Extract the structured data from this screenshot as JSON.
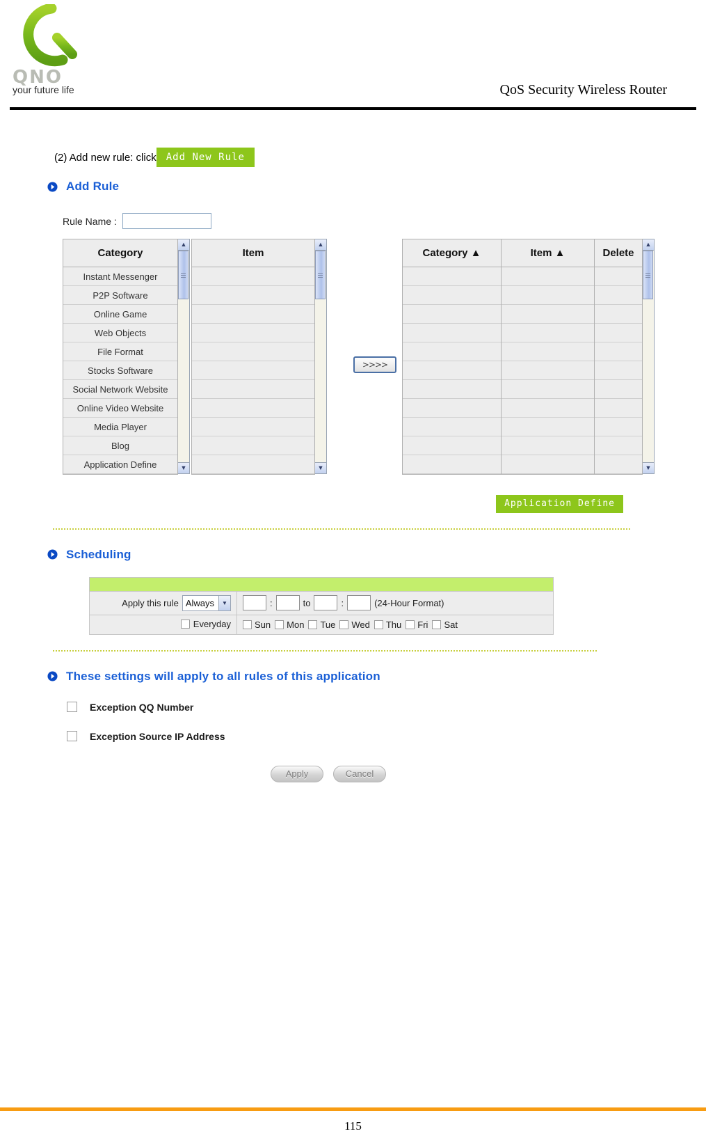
{
  "header": {
    "brand_mark": "QNO",
    "brand_tagline": "your future life",
    "title": "QoS Security Wireless Router"
  },
  "step": {
    "text": "(2) Add new rule: click",
    "button_label": "Add New Rule"
  },
  "add_rule": {
    "section_title": "Add Rule",
    "rule_name_label": "Rule Name :",
    "rule_name_value": "",
    "rule_name_placeholder": "",
    "available": {
      "category_header": "Category",
      "item_header": "Item",
      "categories": [
        "Instant Messenger",
        "P2P Software",
        "Online Game",
        "Web Objects",
        "File Format",
        "Stocks Software",
        "Social Network Website",
        "Online Video Website",
        "Media Player",
        "Blog",
        "Application Define"
      ],
      "items": [
        "",
        "",
        "",
        "",
        "",
        "",
        "",
        "",
        "",
        "",
        ""
      ]
    },
    "move_button_label": ">>>>",
    "selected": {
      "headers": [
        "Category ▲",
        "Item      ▲",
        "Delete"
      ],
      "rows": [
        [
          "",
          "",
          ""
        ],
        [
          "",
          "",
          ""
        ],
        [
          "",
          "",
          ""
        ],
        [
          "",
          "",
          ""
        ],
        [
          "",
          "",
          ""
        ],
        [
          "",
          "",
          ""
        ],
        [
          "",
          "",
          ""
        ],
        [
          "",
          "",
          ""
        ],
        [
          "",
          "",
          ""
        ],
        [
          "",
          "",
          ""
        ],
        [
          "",
          "",
          ""
        ]
      ]
    },
    "application_define_label": "Application Define"
  },
  "scheduling": {
    "section_title": "Scheduling",
    "apply_label": "Apply this rule",
    "apply_value": "Always",
    "apply_options": [
      "Always"
    ],
    "time_sep": ":",
    "to_label": "to",
    "format_note": "(24-Hour Format)",
    "start_hour": "",
    "start_minute": "",
    "end_hour": "",
    "end_minute": "",
    "everyday_label": "Everyday",
    "days": [
      "Sun",
      "Mon",
      "Tue",
      "Wed",
      "Thu",
      "Fri",
      "Sat"
    ]
  },
  "exceptions": {
    "section_title": "These settings will apply to all rules of this application",
    "items": [
      "Exception QQ Number",
      "Exception Source IP Address"
    ]
  },
  "actions": {
    "apply_label": "Apply",
    "cancel_label": "Cancel"
  },
  "footer": {
    "page_number": "115"
  },
  "colors": {
    "accent_green": "#8dc61b",
    "section_blue": "#1a5fd6",
    "footer_orange": "#f89c12",
    "schedule_bar_green": "#c3ee6c"
  }
}
